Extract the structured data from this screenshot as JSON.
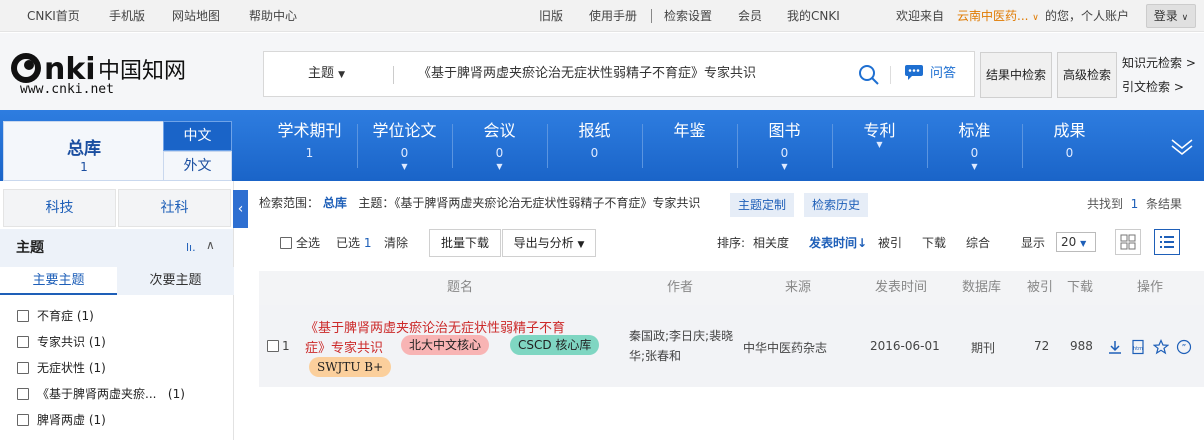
{
  "topbar": {
    "left_links": [
      "CNKI首页",
      "手机版",
      "网站地图",
      "帮助中心"
    ],
    "right_links": [
      "旧版",
      "使用手册",
      "检索设置",
      "会员",
      "我的CNKI"
    ],
    "welcome_prefix": "欢迎来自",
    "org": "云南中医药...",
    "welcome_suffix": "的您，个人账户",
    "login": "登录"
  },
  "logo": {
    "main": "CNKI中国知网",
    "url": "www.cnki.net"
  },
  "search": {
    "field": "主题",
    "query": "《基于脾肾两虚夹瘀论治无症状性弱精子不育症》专家共识",
    "ask": "问答"
  },
  "header_buttons": {
    "in_results": "结果中检索",
    "advanced": "高级检索"
  },
  "header_links": {
    "knowledge": "知识元检索",
    "citation": "引文检索"
  },
  "nav": {
    "zongku": {
      "label": "总库",
      "count": "1"
    },
    "lang_cn": "中文",
    "lang_en": "外文",
    "dbs": [
      {
        "name": "学术期刊",
        "count": "1"
      },
      {
        "name": "学位论文",
        "count": "0"
      },
      {
        "name": "会议",
        "count": "0"
      },
      {
        "name": "报纸",
        "count": "0"
      },
      {
        "name": "年鉴",
        "count": ""
      },
      {
        "name": "图书",
        "count": "0"
      },
      {
        "name": "专利",
        "count": ""
      },
      {
        "name": "标准",
        "count": "0"
      },
      {
        "name": "成果",
        "count": "0"
      }
    ]
  },
  "sidebar": {
    "tabs": [
      "科技",
      "社科"
    ],
    "section": "主题",
    "subtabs": [
      "主要主题",
      "次要主题"
    ],
    "items": [
      {
        "label": "不育症",
        "count": "(1)"
      },
      {
        "label": "专家共识",
        "count": "(1)"
      },
      {
        "label": "无症状性",
        "count": "(1)"
      },
      {
        "label": "《基于脾肾两虚夹瘀...",
        "count": "(1)"
      },
      {
        "label": "脾肾两虚",
        "count": "(1)"
      }
    ]
  },
  "scope": {
    "prefix": "检索范围：",
    "db": "总库",
    "topic": "主题：《基于脾肾两虚夹瘀论治无症状性弱精子不育症》专家共识",
    "custom": "主题定制",
    "history": "检索历史",
    "found_prefix": "共找到",
    "found_count": "1",
    "found_suffix": "条结果"
  },
  "toolbar": {
    "select_all": "全选",
    "selected_label": "已选",
    "selected_count": "1",
    "clear": "清除",
    "batch_download": "批量下载",
    "export": "导出与分析",
    "sort_label": "排序:",
    "sort_options": [
      "相关度",
      "发表时间",
      "被引",
      "下载",
      "综合"
    ],
    "display_label": "显示",
    "page_size": "20"
  },
  "table": {
    "headers": [
      "题名",
      "作者",
      "来源",
      "发表时间",
      "数据库",
      "被引",
      "下载",
      "操作"
    ],
    "rows": [
      {
        "index": "1",
        "title_line1": "《基于脾肾两虚夹瘀论治无症状性弱精子不育",
        "title_line2": "症》专家共识",
        "tags": [
          "北大中文核心",
          "CSCD 核心库",
          "SWJTU B+"
        ],
        "authors_line1": "秦国政;李日庆;裴晓",
        "authors_line2": "华;张春和",
        "source": "中华中医药杂志",
        "date": "2016-06-01",
        "db": "期刊",
        "cited": "72",
        "downloads": "988"
      }
    ]
  },
  "colors": {
    "brand_blue": "#1a64c8",
    "title_red": "#cc2a2a",
    "tag_pink": "#f8b4b4",
    "tag_green": "#7fd6c2",
    "tag_orange": "#fbcf9c"
  }
}
